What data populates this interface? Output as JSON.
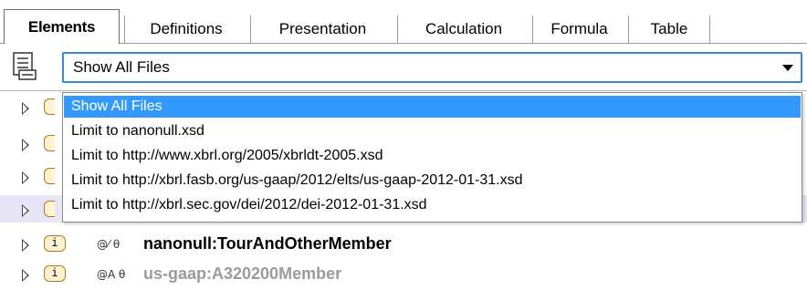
{
  "tabs": [
    {
      "label": "Elements",
      "active": true
    },
    {
      "label": "Definitions",
      "active": false
    },
    {
      "label": "Presentation",
      "active": false
    },
    {
      "label": "Calculation",
      "active": false
    },
    {
      "label": "Formula",
      "active": false
    },
    {
      "label": "Table",
      "active": false
    }
  ],
  "toolbar": {
    "files_icon": "file-list-icon",
    "filter": {
      "value": "Show All Files",
      "options": [
        "Show All Files",
        "Limit to nanonull.xsd",
        "Limit to http://www.xbrl.org/2005/xbrldt-2005.xsd",
        "Limit to http://xbrl.fasb.org/us-gaap/2012/elts/us-gaap-2012-01-31.xsd",
        "Limit to http://xbrl.sec.gov/dei/2012/dei-2012-01-31.xsd"
      ],
      "selected_index": 0
    }
  },
  "tree": {
    "rows": [
      {
        "badge": "i",
        "props": "",
        "name": ""
      },
      {
        "badge": "i",
        "props": "",
        "name": ""
      },
      {
        "badge": "i",
        "props": "",
        "name": ""
      },
      {
        "badge": "i",
        "props": "",
        "name": ""
      },
      {
        "badge": "i",
        "props": "@⁄ θ",
        "name": "nanonull:TourAndOtherMember"
      },
      {
        "badge": "i",
        "props": "@A θ",
        "name": "us-gaap:A320200Member"
      }
    ]
  },
  "colors": {
    "selection": "#3399ff",
    "combo_border": "#3b86d1",
    "highlight_row": "#e8e6f6",
    "element_badge_fill": "#fff3d4",
    "element_badge_border": "#b07a18",
    "dim_text": "#9b9b9b"
  }
}
